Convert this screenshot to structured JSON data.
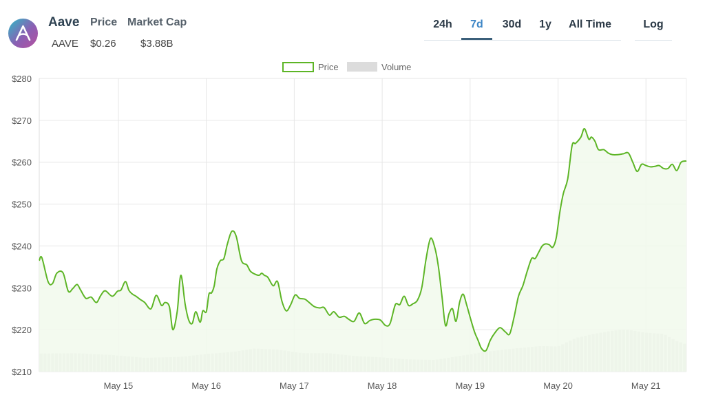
{
  "header": {
    "coin_name": "Aave",
    "coin_symbol": "AAVE",
    "price_label": "Price",
    "price_value": "$0.26",
    "market_cap_label": "Market Cap",
    "market_cap_value": "$3.88B"
  },
  "range_tabs": [
    {
      "label": "24h",
      "active": false
    },
    {
      "label": "7d",
      "active": true
    },
    {
      "label": "30d",
      "active": false
    },
    {
      "label": "1y",
      "active": false
    },
    {
      "label": "All Time",
      "active": false
    }
  ],
  "log_toggle": {
    "label": "Log"
  },
  "colors": {
    "price_line": "#5db526",
    "price_fill": "#f1f9ec",
    "volume_bar": "#dcdcdc",
    "active_tab": "#3d86c6",
    "grid": "#e6e6e6"
  },
  "chart_data": {
    "type": "line",
    "legend": [
      {
        "name": "Price",
        "style": "outlined-box",
        "color": "#5db526"
      },
      {
        "name": "Volume",
        "style": "filled-box",
        "color": "#dcdcdc"
      }
    ],
    "legend_position": "top-center",
    "grid": true,
    "y_axis": {
      "ylim": [
        210,
        280
      ],
      "ticks": [
        210,
        220,
        230,
        240,
        250,
        260,
        270,
        280
      ],
      "tick_labels": [
        "$210",
        "$220",
        "$230",
        "$240",
        "$250",
        "$260",
        "$270",
        "$280"
      ]
    },
    "x_axis": {
      "xlim": [
        14.1,
        21.46
      ],
      "ticks": [
        15,
        16,
        17,
        18,
        19,
        20,
        21
      ],
      "tick_labels": [
        "May 15",
        "May 16",
        "May 17",
        "May 18",
        "May 19",
        "May 20",
        "May 21"
      ]
    },
    "series": [
      {
        "name": "Price",
        "x": [
          14.1,
          14.13,
          14.2,
          14.25,
          14.3,
          14.37,
          14.43,
          14.48,
          14.53,
          14.57,
          14.63,
          14.69,
          14.75,
          14.8,
          14.85,
          14.93,
          14.99,
          15.03,
          15.08,
          15.12,
          15.16,
          15.2,
          15.25,
          15.3,
          15.37,
          15.43,
          15.49,
          15.53,
          15.58,
          15.62,
          15.67,
          15.71,
          15.76,
          15.8,
          15.84,
          15.88,
          15.93,
          15.96,
          16.0,
          16.03,
          16.06,
          16.09,
          16.12,
          16.16,
          16.2,
          16.24,
          16.29,
          16.34,
          16.4,
          16.46,
          16.5,
          16.55,
          16.6,
          16.63,
          16.66,
          16.7,
          16.76,
          16.81,
          16.86,
          16.91,
          16.96,
          17.01,
          17.06,
          17.12,
          17.17,
          17.23,
          17.29,
          17.34,
          17.4,
          17.45,
          17.51,
          17.57,
          17.62,
          17.68,
          17.74,
          17.8,
          17.86,
          17.92,
          17.98,
          18.04,
          18.09,
          18.15,
          18.2,
          18.25,
          18.3,
          18.35,
          18.4,
          18.45,
          18.5,
          18.55,
          18.6,
          18.64,
          18.68,
          18.72,
          18.76,
          18.8,
          18.84,
          18.88,
          18.92,
          18.96,
          19.0,
          19.05,
          19.09,
          19.13,
          19.18,
          19.23,
          19.28,
          19.34,
          19.4,
          19.45,
          19.5,
          19.55,
          19.6,
          19.65,
          19.7,
          19.74,
          19.78,
          19.82,
          19.86,
          19.9,
          19.94,
          19.98,
          20.02,
          20.06,
          20.11,
          20.16,
          20.2,
          20.26,
          20.3,
          20.35,
          20.38,
          20.42,
          20.46,
          20.52,
          20.57,
          20.62,
          20.68,
          20.74,
          20.8,
          20.85,
          20.9,
          20.95,
          21.0,
          21.05,
          21.1,
          21.15,
          21.2,
          21.25,
          21.3,
          21.35,
          21.4,
          21.46
        ],
        "y": [
          236.5,
          237.2,
          231.5,
          231.0,
          233.5,
          233.6,
          229.2,
          229.8,
          230.8,
          229.5,
          227.5,
          227.8,
          226.5,
          228.2,
          229.3,
          228.0,
          229.2,
          229.5,
          231.5,
          229.4,
          228.5,
          228.0,
          227.2,
          226.5,
          225.0,
          228.2,
          225.8,
          226.5,
          225.5,
          220.0,
          224.5,
          233.0,
          226.0,
          222.3,
          221.5,
          224.3,
          221.8,
          224.5,
          224.3,
          228.5,
          228.8,
          230.5,
          234.5,
          236.5,
          237.0,
          240.5,
          243.5,
          242.3,
          236.5,
          235.5,
          234.0,
          233.3,
          233.0,
          233.5,
          233.0,
          232.5,
          230.5,
          231.5,
          226.8,
          224.5,
          226.0,
          228.3,
          227.5,
          227.3,
          226.5,
          225.5,
          225.2,
          225.3,
          223.5,
          224.3,
          223.0,
          223.2,
          222.5,
          222.0,
          224.0,
          221.5,
          222.2,
          222.5,
          222.3,
          221.0,
          221.5,
          226.0,
          226.0,
          228.0,
          225.8,
          226.2,
          227.0,
          230.0,
          237.0,
          241.8,
          239.5,
          235.0,
          228.0,
          221.0,
          223.8,
          225.0,
          222.0,
          226.5,
          228.5,
          226.0,
          223.0,
          219.5,
          217.5,
          215.5,
          215.0,
          217.5,
          219.2,
          220.5,
          219.5,
          219.0,
          223.0,
          228.0,
          230.5,
          234.0,
          237.0,
          237.0,
          238.5,
          240.0,
          240.5,
          240.3,
          239.7,
          242.0,
          248.0,
          252.5,
          256.0,
          264.0,
          264.5,
          266.0,
          268.0,
          265.5,
          266.0,
          265.0,
          263.0,
          263.0,
          262.2,
          261.8,
          261.8,
          262.0,
          262.2,
          260.0,
          257.8,
          259.5,
          259.2,
          258.9,
          259.0,
          259.2,
          258.5,
          258.5,
          259.5,
          258.0,
          260.0,
          260.3
        ],
        "color": "#5db526"
      },
      {
        "name": "Volume",
        "x": [
          14.1,
          14.5,
          14.9,
          15.3,
          15.7,
          16.0,
          16.3,
          16.55,
          16.8,
          17.1,
          17.4,
          17.7,
          18.0,
          18.3,
          18.6,
          18.9,
          19.2,
          19.5,
          19.8,
          20.0,
          20.2,
          20.4,
          20.6,
          20.75,
          20.85,
          21.0,
          21.2,
          21.35,
          21.46
        ],
        "y": [
          214.3,
          214.4,
          214.0,
          213.3,
          213.5,
          214.2,
          214.7,
          215.5,
          215.3,
          214.4,
          214.4,
          213.7,
          213.4,
          212.9,
          212.8,
          213.8,
          214.8,
          215.5,
          216.1,
          216.0,
          218.0,
          219.0,
          219.7,
          220.0,
          219.8,
          219.3,
          219.0,
          217.3,
          216.5
        ],
        "color": "#dcdcdc"
      }
    ]
  }
}
